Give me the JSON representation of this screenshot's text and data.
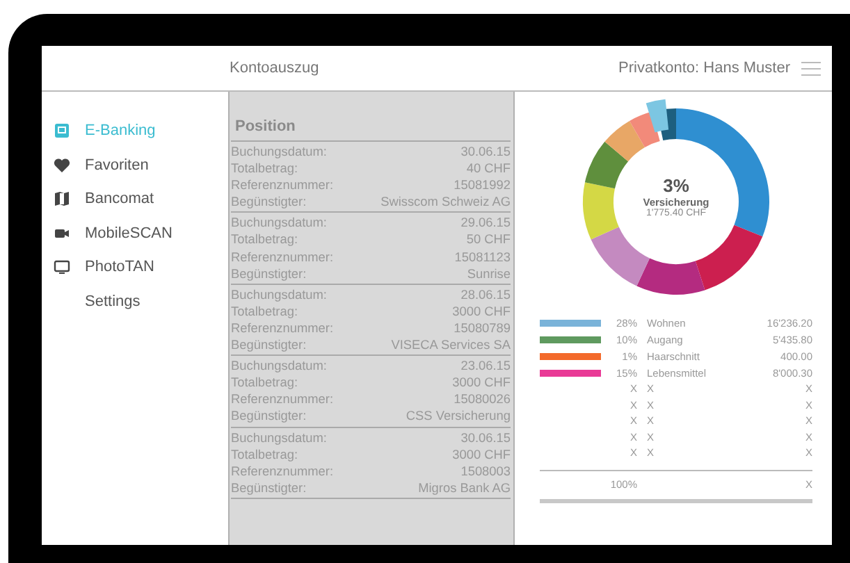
{
  "header": {
    "title": "Kontoauszug",
    "account": "Privatkonto: Hans Muster"
  },
  "sidebar": {
    "items": [
      {
        "label": "E-Banking",
        "selected": true
      },
      {
        "label": "Favoriten",
        "selected": false
      },
      {
        "label": "Bancomat",
        "selected": false
      },
      {
        "label": "MobileSCAN",
        "selected": false
      },
      {
        "label": "PhotoTAN",
        "selected": false
      },
      {
        "label": "Settings",
        "selected": false
      }
    ]
  },
  "statement": {
    "heading": "Position",
    "entries": [
      {
        "fields": [
          {
            "label": "Buchungsdatum:",
            "value": "30.06.15"
          },
          {
            "label": "Totalbetrag:",
            "value": "40 CHF"
          },
          {
            "label": "Referenznummer:",
            "value": "15081992"
          },
          {
            "label": "Begünstigter:",
            "value": "Swisscom Schweiz AG"
          }
        ]
      },
      {
        "fields": [
          {
            "label": "Buchungsdatum:",
            "value": "29.06.15"
          },
          {
            "label": "Totalbetrag:",
            "value": "50 CHF"
          },
          {
            "label": "Referenznummer:",
            "value": "15081123"
          },
          {
            "label": "Begünstigter:",
            "value": "Sunrise"
          }
        ]
      },
      {
        "fields": [
          {
            "label": "Buchungsdatum:",
            "value": "28.06.15"
          },
          {
            "label": "Totalbetrag:",
            "value": "3000 CHF"
          },
          {
            "label": "Referenznummer:",
            "value": "15080789"
          },
          {
            "label": "Begünstigter:",
            "value": "VISECA Services SA"
          }
        ]
      },
      {
        "fields": [
          {
            "label": "Buchungsdatum:",
            "value": "23.06.15"
          },
          {
            "label": "Totalbetrag:",
            "value": "3000 CHF"
          },
          {
            "label": "Referenznummer:",
            "value": "15080026"
          },
          {
            "label": "Begünstigter:",
            "value": "CSS Versicherung"
          }
        ]
      },
      {
        "fields": [
          {
            "label": "Buchungsdatum:",
            "value": "30.06.15"
          },
          {
            "label": "Totalbetrag:",
            "value": "3000 CHF"
          },
          {
            "label": "Referenznummer:",
            "value": "1508003"
          },
          {
            "label": "Begünstigter:",
            "value": "Migros Bank AG"
          }
        ]
      }
    ]
  },
  "budget": {
    "donut_center": {
      "percent": "3%",
      "category": "Versicherung",
      "amount": "1'775.40 CHF"
    },
    "legend": [
      {
        "color": "#7ab3d9",
        "percent": "28%",
        "label": "Wohnen",
        "amount": "16'236.20"
      },
      {
        "color": "#5f9a5f",
        "percent": "10%",
        "label": "Augang",
        "amount": "5'435.80"
      },
      {
        "color": "#f36a2b",
        "percent": "1%",
        "label": "Haarschnitt",
        "amount": "400.00"
      },
      {
        "color": "#e93a96",
        "percent": "15%",
        "label": "Lebensmittel",
        "amount": "8'000.30"
      },
      {
        "percent": "X",
        "label": "X",
        "amount": "X"
      },
      {
        "percent": "X",
        "label": "X",
        "amount": "X"
      },
      {
        "percent": "X",
        "label": "X",
        "amount": "X"
      },
      {
        "percent": "X",
        "label": "X",
        "amount": "X"
      },
      {
        "percent": "X",
        "label": "X",
        "amount": "X"
      }
    ],
    "total": {
      "percent": "100%",
      "amount": "X"
    }
  }
}
